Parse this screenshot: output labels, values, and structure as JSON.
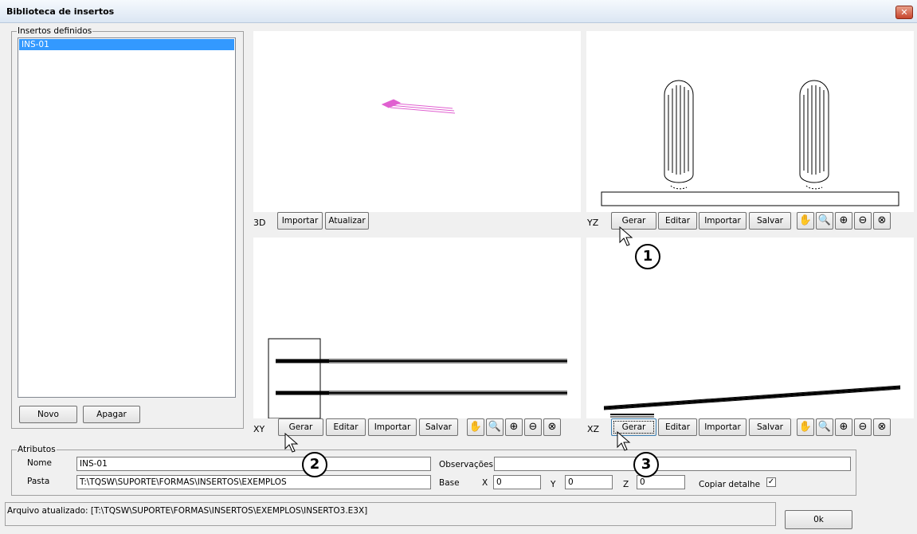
{
  "window": {
    "title": "Biblioteca de insertos",
    "close_glyph": "✕"
  },
  "left": {
    "group_label": "Insertos definidos",
    "items": [
      "INS-01"
    ],
    "novo_label": "Novo",
    "apagar_label": "Apagar"
  },
  "views": {
    "v3d": {
      "label": "3D",
      "importar": "Importar",
      "atualizar": "Atualizar"
    },
    "yz": {
      "label": "YZ",
      "gerar": "Gerar",
      "editar": "Editar",
      "importar": "Importar",
      "salvar": "Salvar"
    },
    "xy": {
      "label": "XY",
      "gerar": "Gerar",
      "editar": "Editar",
      "importar": "Importar",
      "salvar": "Salvar"
    },
    "xz": {
      "label": "XZ",
      "gerar": "Gerar",
      "editar": "Editar",
      "importar": "Importar",
      "salvar": "Salvar"
    }
  },
  "zoom_icons": [
    "pan-icon",
    "zoom-window-icon",
    "zoom-extents-icon",
    "zoom-out-icon",
    "zoom-previous-icon"
  ],
  "attributes": {
    "group_label": "Atributos",
    "nome_label": "Nome",
    "nome_value": "INS-01",
    "pasta_label": "Pasta",
    "pasta_value": "T:\\TQSW\\SUPORTE\\FORMAS\\INSERTOS\\EXEMPLOS",
    "observacoes_label": "Observações",
    "observacoes_value": "",
    "base_label": "Base",
    "x_label": "X",
    "x_value": "0",
    "y_label": "Y",
    "y_value": "0",
    "z_label": "Z",
    "z_value": "0",
    "copiar_label": "Copiar detalhe",
    "copiar_checked": "✓"
  },
  "status_text": "Arquivo atualizado: [T:\\TQSW\\SUPORTE\\FORMAS\\INSERTOS\\EXEMPLOS\\INSERTO3.E3X]",
  "ok_label": "0k",
  "markers": [
    "1",
    "2",
    "3"
  ],
  "colors": {
    "selection": "#3399ff",
    "insert3d": "#e060d0"
  }
}
